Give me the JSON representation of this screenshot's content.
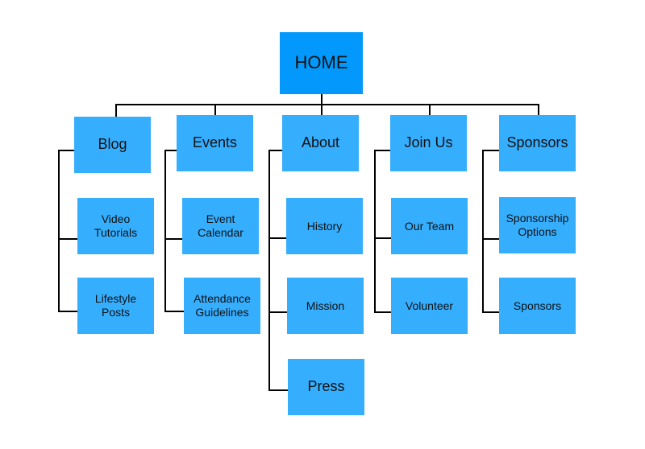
{
  "diagram": {
    "type": "site-map",
    "colors": {
      "root": "#0399fc",
      "node": "#36aefe",
      "connector": "#000000"
    },
    "root": {
      "label": "HOME"
    },
    "sections": [
      {
        "label": "Blog",
        "children": [
          "Video\nTutorials",
          "Lifestyle\nPosts"
        ]
      },
      {
        "label": "Events",
        "children": [
          "Event\nCalendar",
          "Attendance\nGuidelines"
        ]
      },
      {
        "label": "About",
        "children": [
          "History",
          "Mission",
          "Press"
        ]
      },
      {
        "label": "Join Us",
        "children": [
          "Our Team",
          "Volunteer"
        ]
      },
      {
        "label": "Sponsors",
        "children": [
          "Sponsorship\nOptions",
          "Sponsors"
        ]
      }
    ]
  }
}
